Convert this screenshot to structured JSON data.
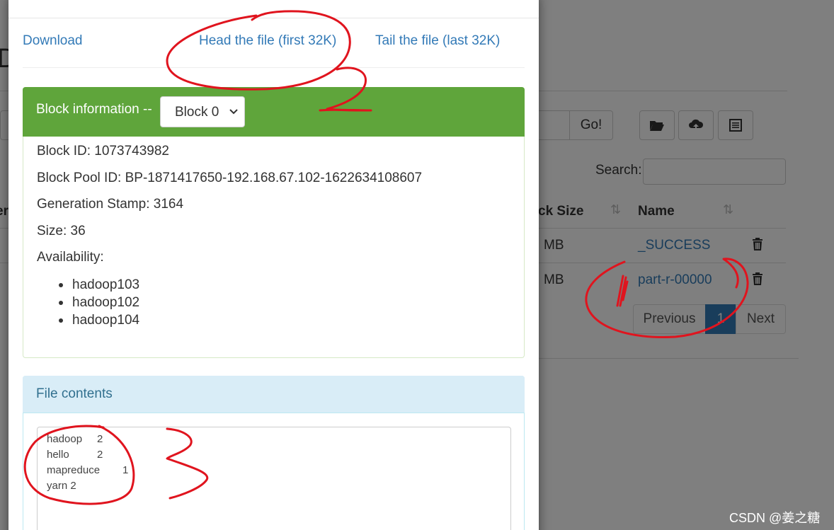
{
  "background": {
    "go_label": "Go!",
    "search_label": "Search:",
    "columns": {
      "block_size": "ck Size",
      "name": "Name"
    },
    "rows": [
      {
        "size": "MB",
        "name": "_SUCCESS"
      },
      {
        "size": "MB",
        "name": "part-r-00000"
      }
    ],
    "pager": {
      "previous": "Previous",
      "current": "1",
      "next": "Next"
    },
    "colors": {
      "link": "#337ab7",
      "pager_active": "#337ab7"
    }
  },
  "modal": {
    "file_links": {
      "download": "Download",
      "head": "Head the file (first 32K)",
      "tail": "Tail the file (last 32K)"
    },
    "block_panel": {
      "title": "Block information --",
      "selected_block": "Block 0",
      "block_id": "Block ID: 1073743982",
      "block_pool_id": "Block Pool ID: BP-1871417650-192.168.67.102-1622634108607",
      "generation_stamp": "Generation Stamp: 3164",
      "size": "Size: 36",
      "availability_label": "Availability:",
      "availability": [
        "hadoop103",
        "hadoop102",
        "hadoop104"
      ],
      "header_color": "#5fa53b"
    },
    "contents_panel": {
      "title": "File contents",
      "lines": [
        "hadoop\t2",
        "hello\t2",
        "mapreduce\t1",
        "yarn 2"
      ],
      "header_color": "#d9edf7"
    }
  },
  "annotations": {
    "labels": [
      "2",
      "3"
    ],
    "color": "#e0141e"
  },
  "watermark": "CSDN @姜之糖"
}
